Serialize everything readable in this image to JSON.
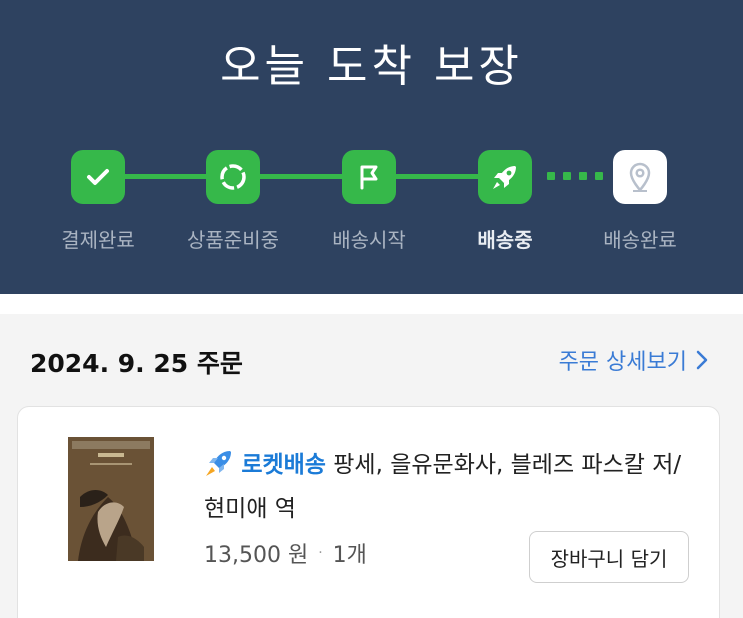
{
  "header": {
    "title": "오늘 도착 보장"
  },
  "steps": [
    {
      "label": "결제완료",
      "icon": "check-icon"
    },
    {
      "label": "상품준비중",
      "icon": "circle-dashed-icon"
    },
    {
      "label": "배송시작",
      "icon": "flag-icon"
    },
    {
      "label": "배송중",
      "icon": "rocket-icon"
    },
    {
      "label": "배송완료",
      "icon": "location-pin-icon"
    }
  ],
  "order": {
    "date": "2024. 9. 25 주문",
    "detail_link": "주문 상세보기"
  },
  "product": {
    "badge": "로켓배송",
    "title": "팡세, 을유문화사, 블레즈 파스칼 저/현미애 역",
    "price": "13,500 원",
    "separator": "·",
    "quantity": "1개",
    "cart_button": "장바구니 담기"
  },
  "colors": {
    "header_bg": "#2e4260",
    "progress_green": "#36b84a",
    "link_blue": "#3a7bd5",
    "rocket_blue": "#1b7bd7"
  }
}
